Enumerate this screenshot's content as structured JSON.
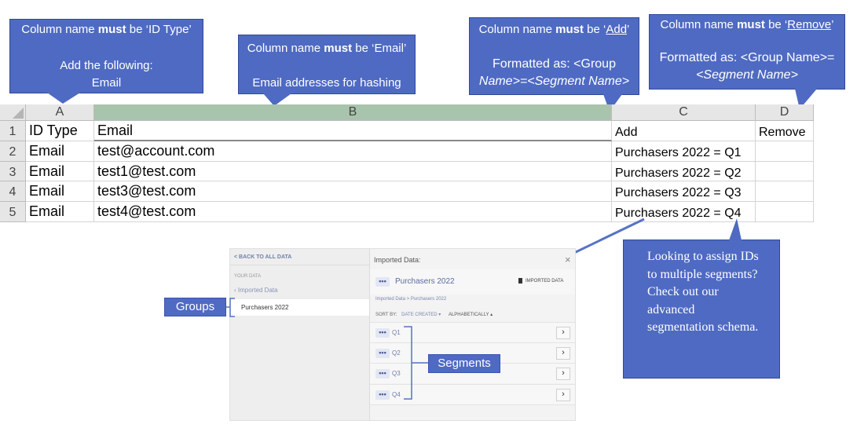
{
  "callouts": {
    "id_type": {
      "line1_pre": "Column name ",
      "line1_bold": "must",
      "line1_post": " be ‘ID Type’",
      "line2": "Add the following:",
      "line3": "Email"
    },
    "email": {
      "line1_pre": "Column name ",
      "line1_bold": "must",
      "line1_post": " be ‘Email’",
      "line2": "Email addresses for hashing"
    },
    "add": {
      "line1_pre": "Column name ",
      "line1_bold": "must",
      "line1_post_a": " be ‘",
      "line1_u": "Add",
      "line1_post_b": "’",
      "line2": "Formatted as:  <Group",
      "line3": "Name>=<Segment Name>"
    },
    "remove": {
      "line1_pre": "Column name ",
      "line1_bold": "must",
      "line1_post_a": " be ‘",
      "line1_u": "Remove",
      "line1_post_b": "’",
      "line2": "Formatted as:  <Group Name>=",
      "line3": "<Segment Name>"
    },
    "advanced": {
      "text": "Looking to assign IDs to multiple segments? Check out our advanced segmentation schema."
    }
  },
  "sheet": {
    "columns": [
      "A",
      "B",
      "C",
      "D"
    ],
    "row_numbers": [
      "1",
      "2",
      "3",
      "4",
      "5"
    ],
    "rows": [
      [
        "ID Type",
        "Email",
        "Add",
        "Remove"
      ],
      [
        "Email",
        "test@account.com",
        "Purchasers 2022 = Q1",
        ""
      ],
      [
        "Email",
        "test1@test.com",
        "Purchasers 2022 = Q2",
        ""
      ],
      [
        "Email",
        "test3@test.com",
        "Purchasers 2022 = Q3",
        ""
      ],
      [
        "Email",
        "test4@test.com",
        "Purchasers 2022 = Q4",
        ""
      ]
    ]
  },
  "app": {
    "back_link": "< BACK TO ALL DATA",
    "your_data": "YOUR DATA",
    "imported_data_link": "Imported Data",
    "group_item": "Purchasers 2022",
    "header_title": "Imported Data:",
    "close": "×",
    "group_title": "Purchasers 2022",
    "badge": "IMPORTED DATA",
    "breadcrumb": "Imported Data > Purchasers 2022",
    "sort_by": "SORT BY:",
    "sort_date": "DATE CREATED ▾",
    "sort_alpha": "ALPHABETICALLY ▴",
    "segments": [
      "Q1",
      "Q2",
      "Q3",
      "Q4"
    ],
    "dots": "•••",
    "chevron": "›"
  },
  "labels": {
    "groups": "Groups",
    "segments": "Segments"
  },
  "colors": {
    "callout": "#4f6ac2",
    "selected_header": "#a9c4ac"
  }
}
